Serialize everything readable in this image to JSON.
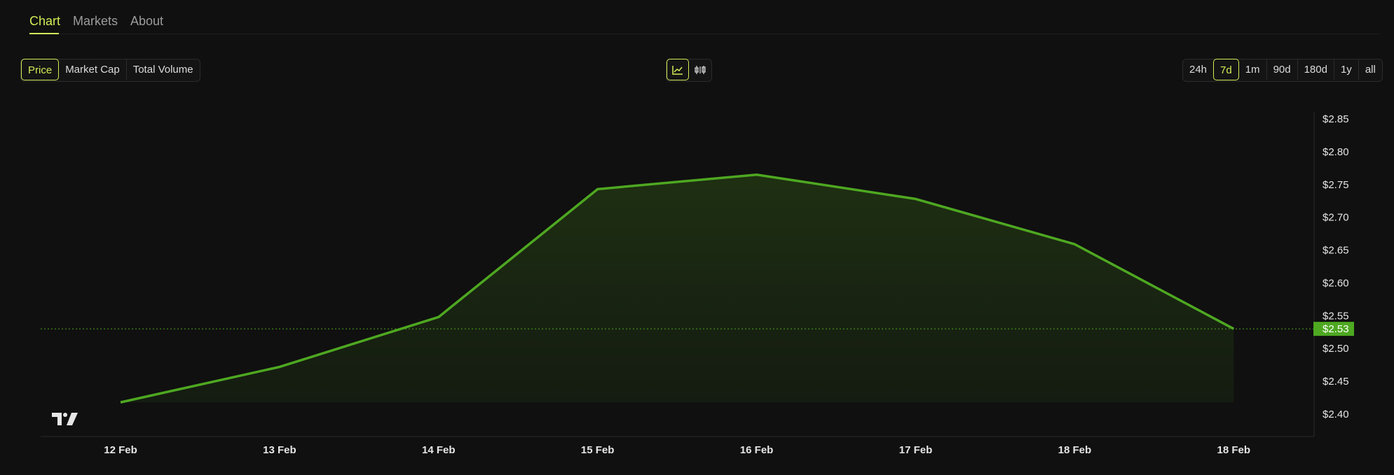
{
  "nav": {
    "tabs": [
      "Chart",
      "Markets",
      "About"
    ]
  },
  "metric_buttons": [
    "Price",
    "Market Cap",
    "Total Volume"
  ],
  "view_buttons": {
    "line_icon": "line-chart-icon",
    "candle_icon": "candlestick-icon"
  },
  "range_buttons": [
    "24h",
    "7d",
    "1m",
    "90d",
    "180d",
    "1y",
    "all"
  ],
  "colors": {
    "accent": "#d2ec57",
    "line": "#4ea821",
    "tag": "#4ea821",
    "bg": "#101010"
  },
  "logo_text": "TV",
  "current_price_label": "$2.53",
  "chart_data": {
    "type": "area",
    "title": "",
    "xlabel": "",
    "ylabel": "",
    "x_tick_labels": [
      "12 Feb",
      "13 Feb",
      "14 Feb",
      "15 Feb",
      "16 Feb",
      "17 Feb",
      "18 Feb",
      "18 Feb"
    ],
    "y_tick_labels": [
      "$2.85",
      "$2.80",
      "$2.75",
      "$2.70",
      "$2.65",
      "$2.60",
      "$2.55",
      "$2.50",
      "$2.45",
      "$2.40"
    ],
    "ylim": [
      2.4,
      2.85
    ],
    "series": [
      {
        "values": [
          2.418,
          2.472,
          2.548,
          2.743,
          2.765,
          2.728,
          2.659,
          2.53
        ]
      }
    ],
    "current_price": 2.53,
    "grid": false
  }
}
